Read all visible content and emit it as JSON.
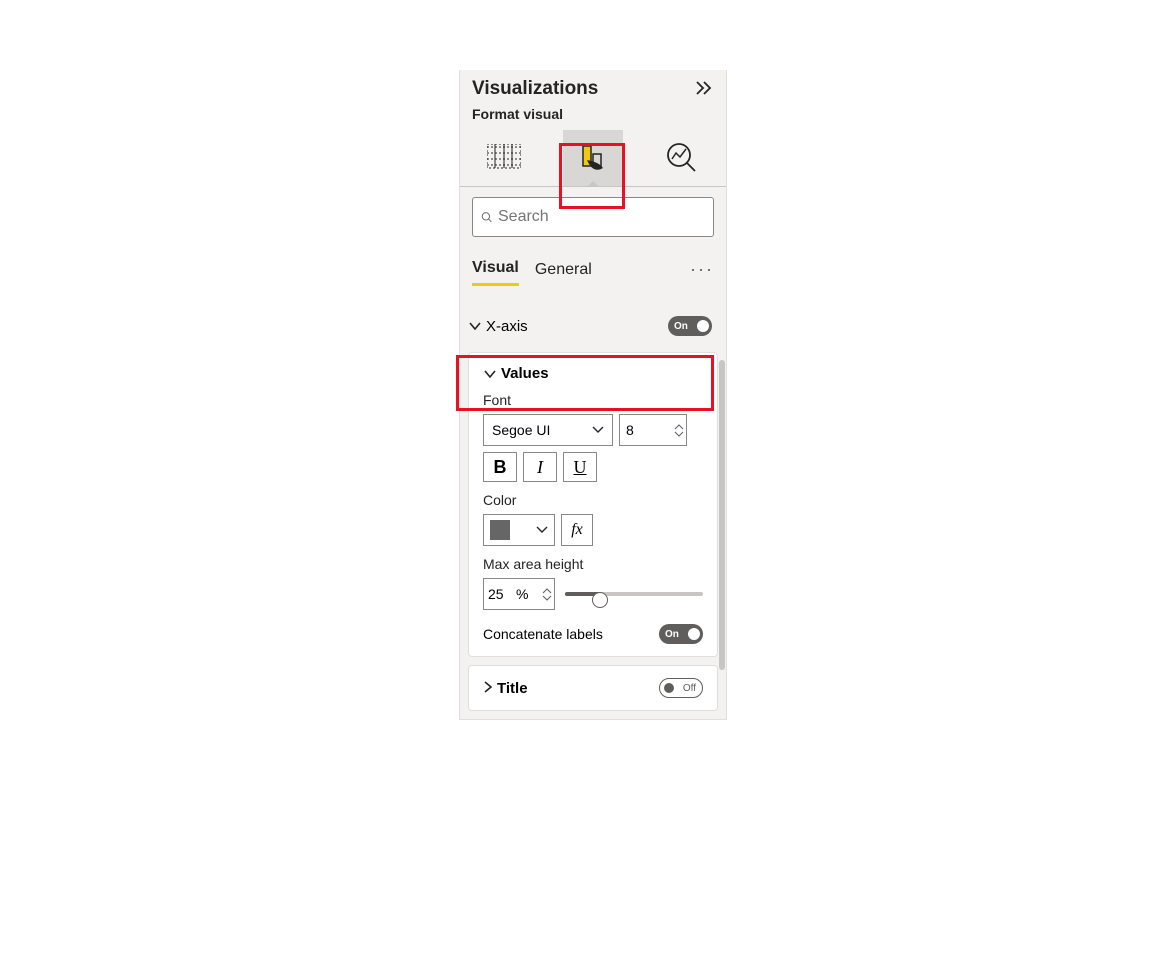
{
  "panel": {
    "title": "Visualizations",
    "subtitle": "Format visual"
  },
  "search": {
    "placeholder": "Search"
  },
  "tabs": {
    "visual": "Visual",
    "general": "General"
  },
  "sections": {
    "xaxis": {
      "label": "X-axis",
      "toggle": "On"
    },
    "values": {
      "label": "Values",
      "fontLabel": "Font",
      "fontFamily": "Segoe UI",
      "fontSize": "8",
      "colorLabel": "Color",
      "fx": "fx",
      "maxAreaLabel": "Max area height",
      "maxAreaValue": "25",
      "pct": "%",
      "concatLabel": "Concatenate labels",
      "concatToggle": "On"
    },
    "title": {
      "label": "Title",
      "toggle": "Off"
    }
  },
  "icons": {
    "bold": "B",
    "italic": "I",
    "underline": "U"
  }
}
